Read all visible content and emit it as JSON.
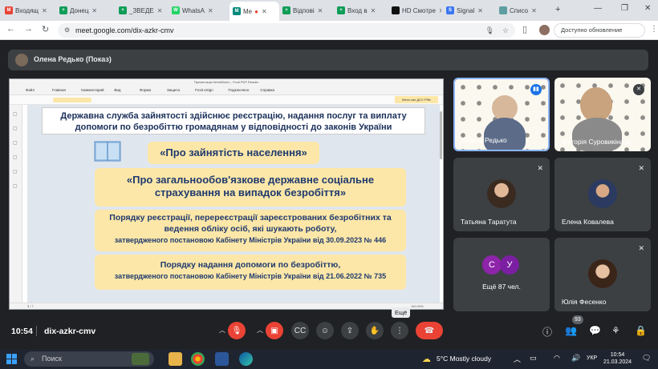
{
  "tabs": [
    {
      "label": "Входящ",
      "color": "#ea4335",
      "icon": "M"
    },
    {
      "label": "Донец",
      "color": "#0f9d58",
      "icon": "+"
    },
    {
      "label": "_ЗВЕДЕ",
      "color": "#0f9d58",
      "icon": "+"
    },
    {
      "label": "WhatsA",
      "color": "#25d366",
      "icon": "W"
    },
    {
      "label": "Me",
      "color": "#00897b",
      "icon": "M",
      "active": true
    },
    {
      "label": "Відпові",
      "color": "#0f9d58",
      "icon": "+"
    },
    {
      "label": "Вход в",
      "color": "#0f9d58",
      "icon": "+"
    },
    {
      "label": "HD Смотре",
      "color": "#111111",
      "icon": ""
    },
    {
      "label": "Signal",
      "color": "#3a76f0",
      "icon": "S"
    },
    {
      "label": "Списо",
      "color": "#5f9ea0",
      "icon": ""
    }
  ],
  "url": "meet.google.com/dix-azkr-cmv",
  "update_label": "Доступно обновление Chrome",
  "presenter": "Олена Редько (Показ)",
  "ppt": {
    "title": "Презентація WordWorld – Foxit PDF Reader",
    "ribbon": [
      "Файл",
      "Главная",
      "Комментарий",
      "Вид",
      "Форма",
      "Защита",
      "Foxit eSign",
      "Подключено",
      "Справка"
    ],
    "status": "3 / 7",
    "zoom": "110,00%"
  },
  "slide": {
    "intro": "Державна служба зайнятості здійснює реєстрацію, надання послуг та виплату допомоги по безробіттю громадянам у відповідності до законів України",
    "law1": "«Про зайнятість населення»",
    "law2": "«Про загальнообов'язкове державне соціальне страхування на випадок безробіття»",
    "law3a": "Порядку реєстрації, перереєстрації зареєстрованих безробітних та ведення обліку осіб, які шукають роботу,",
    "law3b": "затвердженого постановою Кабінету Міністрів України від 30.09.2023 № 446",
    "law4a": "Порядку надання допомоги по безробіттю,",
    "law4b": "затвердженого постановою Кабінету Міністрів України від 21.06.2022 № 735"
  },
  "participants": [
    {
      "name": "Олена Редько"
    },
    {
      "name": "Вікторія Суровикіна Д..."
    },
    {
      "name": "Татьяна Таратута"
    },
    {
      "name": "Елена Ковалева"
    },
    {
      "name": "Ещё 87 чел.",
      "initials": [
        "С",
        "У"
      ]
    },
    {
      "name": "Юлія Фесенко"
    }
  ],
  "meeting": {
    "time": "10:54",
    "code": "dix-azkr-cmv",
    "tooltip": "Ещё",
    "people_count": "93"
  },
  "taskbar": {
    "search": "Поиск",
    "weather": "5°C  Mostly cloudy",
    "lang": "УКР",
    "time": "10:54",
    "date": "21.03.2024"
  },
  "colors": {
    "end_call": "#ea4335",
    "slide_box": "#fde7a8",
    "slide_text": "#1f3a6e"
  }
}
